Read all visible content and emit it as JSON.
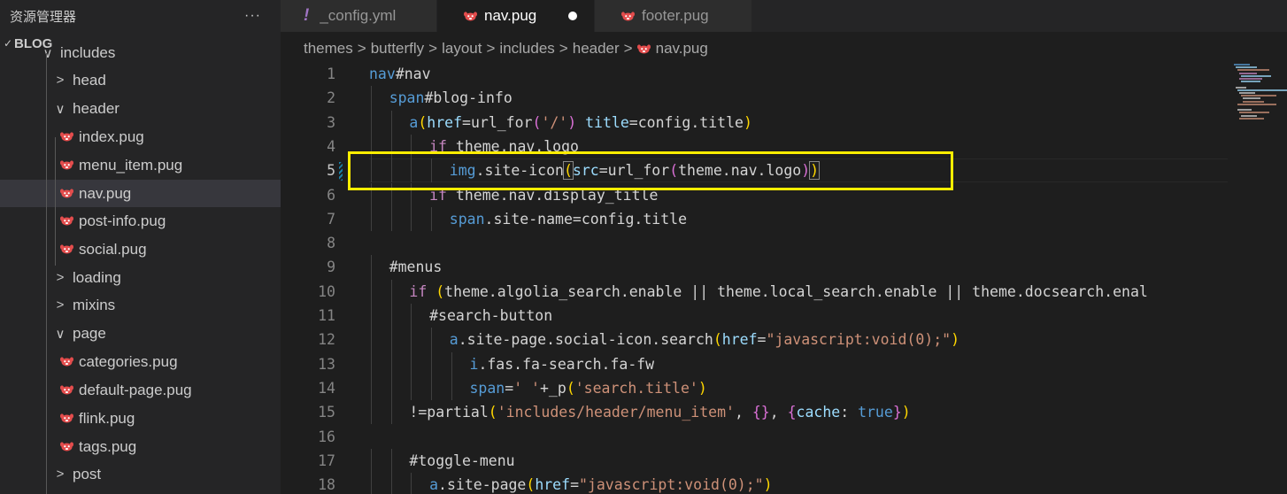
{
  "sidebar": {
    "title": "资源管理器",
    "more": "···",
    "root": "BLOG",
    "items": [
      {
        "label": "includes",
        "type": "folder",
        "open": true,
        "depth": 1
      },
      {
        "label": "head",
        "type": "folder",
        "open": false,
        "depth": 2
      },
      {
        "label": "header",
        "type": "folder",
        "open": true,
        "depth": 2
      },
      {
        "label": "index.pug",
        "type": "file",
        "depth": 3
      },
      {
        "label": "menu_item.pug",
        "type": "file",
        "depth": 3
      },
      {
        "label": "nav.pug",
        "type": "file",
        "depth": 3,
        "selected": true
      },
      {
        "label": "post-info.pug",
        "type": "file",
        "depth": 3
      },
      {
        "label": "social.pug",
        "type": "file",
        "depth": 3
      },
      {
        "label": "loading",
        "type": "folder",
        "open": false,
        "depth": 2
      },
      {
        "label": "mixins",
        "type": "folder",
        "open": false,
        "depth": 2
      },
      {
        "label": "page",
        "type": "folder",
        "open": true,
        "depth": 2
      },
      {
        "label": "categories.pug",
        "type": "file",
        "depth": 3
      },
      {
        "label": "default-page.pug",
        "type": "file",
        "depth": 3
      },
      {
        "label": "flink.pug",
        "type": "file",
        "depth": 3
      },
      {
        "label": "tags.pug",
        "type": "file",
        "depth": 3
      },
      {
        "label": "post",
        "type": "folder",
        "open": false,
        "depth": 2
      }
    ]
  },
  "tabs": [
    {
      "label": "_config.yml",
      "icon": "yaml-exclamation-icon",
      "active": false
    },
    {
      "label": "nav.pug",
      "icon": "pug-icon",
      "active": true,
      "dirty": true
    },
    {
      "label": "footer.pug",
      "icon": "pug-icon",
      "active": false
    }
  ],
  "breadcrumb": [
    "themes",
    "butterfly",
    "layout",
    "includes",
    "header",
    "nav.pug"
  ],
  "editor": {
    "current_line": 5,
    "lines": [
      {
        "n": "1",
        "indent": 0,
        "tokens": [
          [
            "t-tag",
            "nav"
          ],
          [
            "t-plain",
            "#nav"
          ]
        ]
      },
      {
        "n": "2",
        "indent": 1,
        "tokens": [
          [
            "t-tag",
            "span"
          ],
          [
            "t-plain",
            "#blog-info"
          ]
        ]
      },
      {
        "n": "3",
        "indent": 2,
        "tokens": [
          [
            "t-tag",
            "a"
          ],
          [
            "t-brk1",
            "("
          ],
          [
            "t-attr",
            "href"
          ],
          [
            "t-plain",
            "=url_for"
          ],
          [
            "t-brk2",
            "("
          ],
          [
            "t-str",
            "'/'"
          ],
          [
            "t-brk2",
            ")"
          ],
          [
            "t-plain",
            " "
          ],
          [
            "t-attr",
            "title"
          ],
          [
            "t-plain",
            "=config.title"
          ],
          [
            "t-brk1",
            ")"
          ]
        ]
      },
      {
        "n": "4",
        "indent": 3,
        "tokens": [
          [
            "t-kw",
            "if"
          ],
          [
            "t-plain",
            " theme.nav.logo"
          ]
        ]
      },
      {
        "n": "5",
        "indent": 4,
        "tokens": [
          [
            "t-tag",
            "img"
          ],
          [
            "t-plain",
            ".site-icon"
          ],
          [
            "t-brk1",
            "("
          ],
          [
            "t-attr",
            "src"
          ],
          [
            "t-plain",
            "=url_for"
          ],
          [
            "t-brk2",
            "("
          ],
          [
            "t-plain",
            "theme.nav.logo"
          ],
          [
            "t-brk2",
            ")"
          ],
          [
            "t-brk1",
            ")"
          ]
        ]
      },
      {
        "n": "6",
        "indent": 3,
        "tokens": [
          [
            "t-kw",
            "if"
          ],
          [
            "t-plain",
            " theme.nav.display_title"
          ]
        ]
      },
      {
        "n": "7",
        "indent": 4,
        "tokens": [
          [
            "t-tag",
            "span"
          ],
          [
            "t-plain",
            ".site-name=config.title"
          ]
        ]
      },
      {
        "n": "8",
        "indent": 0,
        "tokens": []
      },
      {
        "n": "9",
        "indent": 1,
        "tokens": [
          [
            "t-plain",
            "#menus"
          ]
        ]
      },
      {
        "n": "10",
        "indent": 2,
        "tokens": [
          [
            "t-kw",
            "if"
          ],
          [
            "t-plain",
            " "
          ],
          [
            "t-brk1",
            "("
          ],
          [
            "t-plain",
            "theme.algolia_search.enable || theme.local_search.enable || theme.docsearch.enal"
          ]
        ]
      },
      {
        "n": "11",
        "indent": 3,
        "tokens": [
          [
            "t-plain",
            "#search-button"
          ]
        ]
      },
      {
        "n": "12",
        "indent": 4,
        "tokens": [
          [
            "t-tag",
            "a"
          ],
          [
            "t-plain",
            ".site-page.social-icon.search"
          ],
          [
            "t-brk1",
            "("
          ],
          [
            "t-attr",
            "href"
          ],
          [
            "t-plain",
            "="
          ],
          [
            "t-str",
            "\"javascript:void(0);\""
          ],
          [
            "t-brk1",
            ")"
          ]
        ]
      },
      {
        "n": "13",
        "indent": 5,
        "tokens": [
          [
            "t-tag",
            "i"
          ],
          [
            "t-plain",
            ".fas.fa-search.fa-fw"
          ]
        ]
      },
      {
        "n": "14",
        "indent": 5,
        "tokens": [
          [
            "t-tag",
            "span"
          ],
          [
            "t-plain",
            "="
          ],
          [
            "t-str",
            "' '"
          ],
          [
            "t-plain",
            "+_p"
          ],
          [
            "t-brk1",
            "("
          ],
          [
            "t-str",
            "'search.title'"
          ],
          [
            "t-brk1",
            ")"
          ]
        ]
      },
      {
        "n": "15",
        "indent": 2,
        "tokens": [
          [
            "t-plain",
            "!=partial"
          ],
          [
            "t-brk1",
            "("
          ],
          [
            "t-str",
            "'includes/header/menu_item'"
          ],
          [
            "t-plain",
            ", "
          ],
          [
            "t-brk2",
            "{}"
          ],
          [
            "t-plain",
            ", "
          ],
          [
            "t-brk2",
            "{"
          ],
          [
            "t-attr",
            "cache"
          ],
          [
            "t-plain",
            ": "
          ],
          [
            "t-tag",
            "true"
          ],
          [
            "t-brk2",
            "}"
          ],
          [
            "t-brk1",
            ")"
          ]
        ]
      },
      {
        "n": "16",
        "indent": 0,
        "tokens": []
      },
      {
        "n": "17",
        "indent": 2,
        "tokens": [
          [
            "t-plain",
            "#toggle-menu"
          ]
        ]
      },
      {
        "n": "18",
        "indent": 3,
        "tokens": [
          [
            "t-tag",
            "a"
          ],
          [
            "t-plain",
            ".site-page"
          ],
          [
            "t-brk1",
            "("
          ],
          [
            "t-attr",
            "href"
          ],
          [
            "t-plain",
            "="
          ],
          [
            "t-str",
            "\"javascript:void(0);\""
          ],
          [
            "t-brk1",
            ")"
          ]
        ]
      }
    ]
  },
  "colors": {
    "accent_box": "#ffee00",
    "pug_icon": "#e44d4d"
  }
}
